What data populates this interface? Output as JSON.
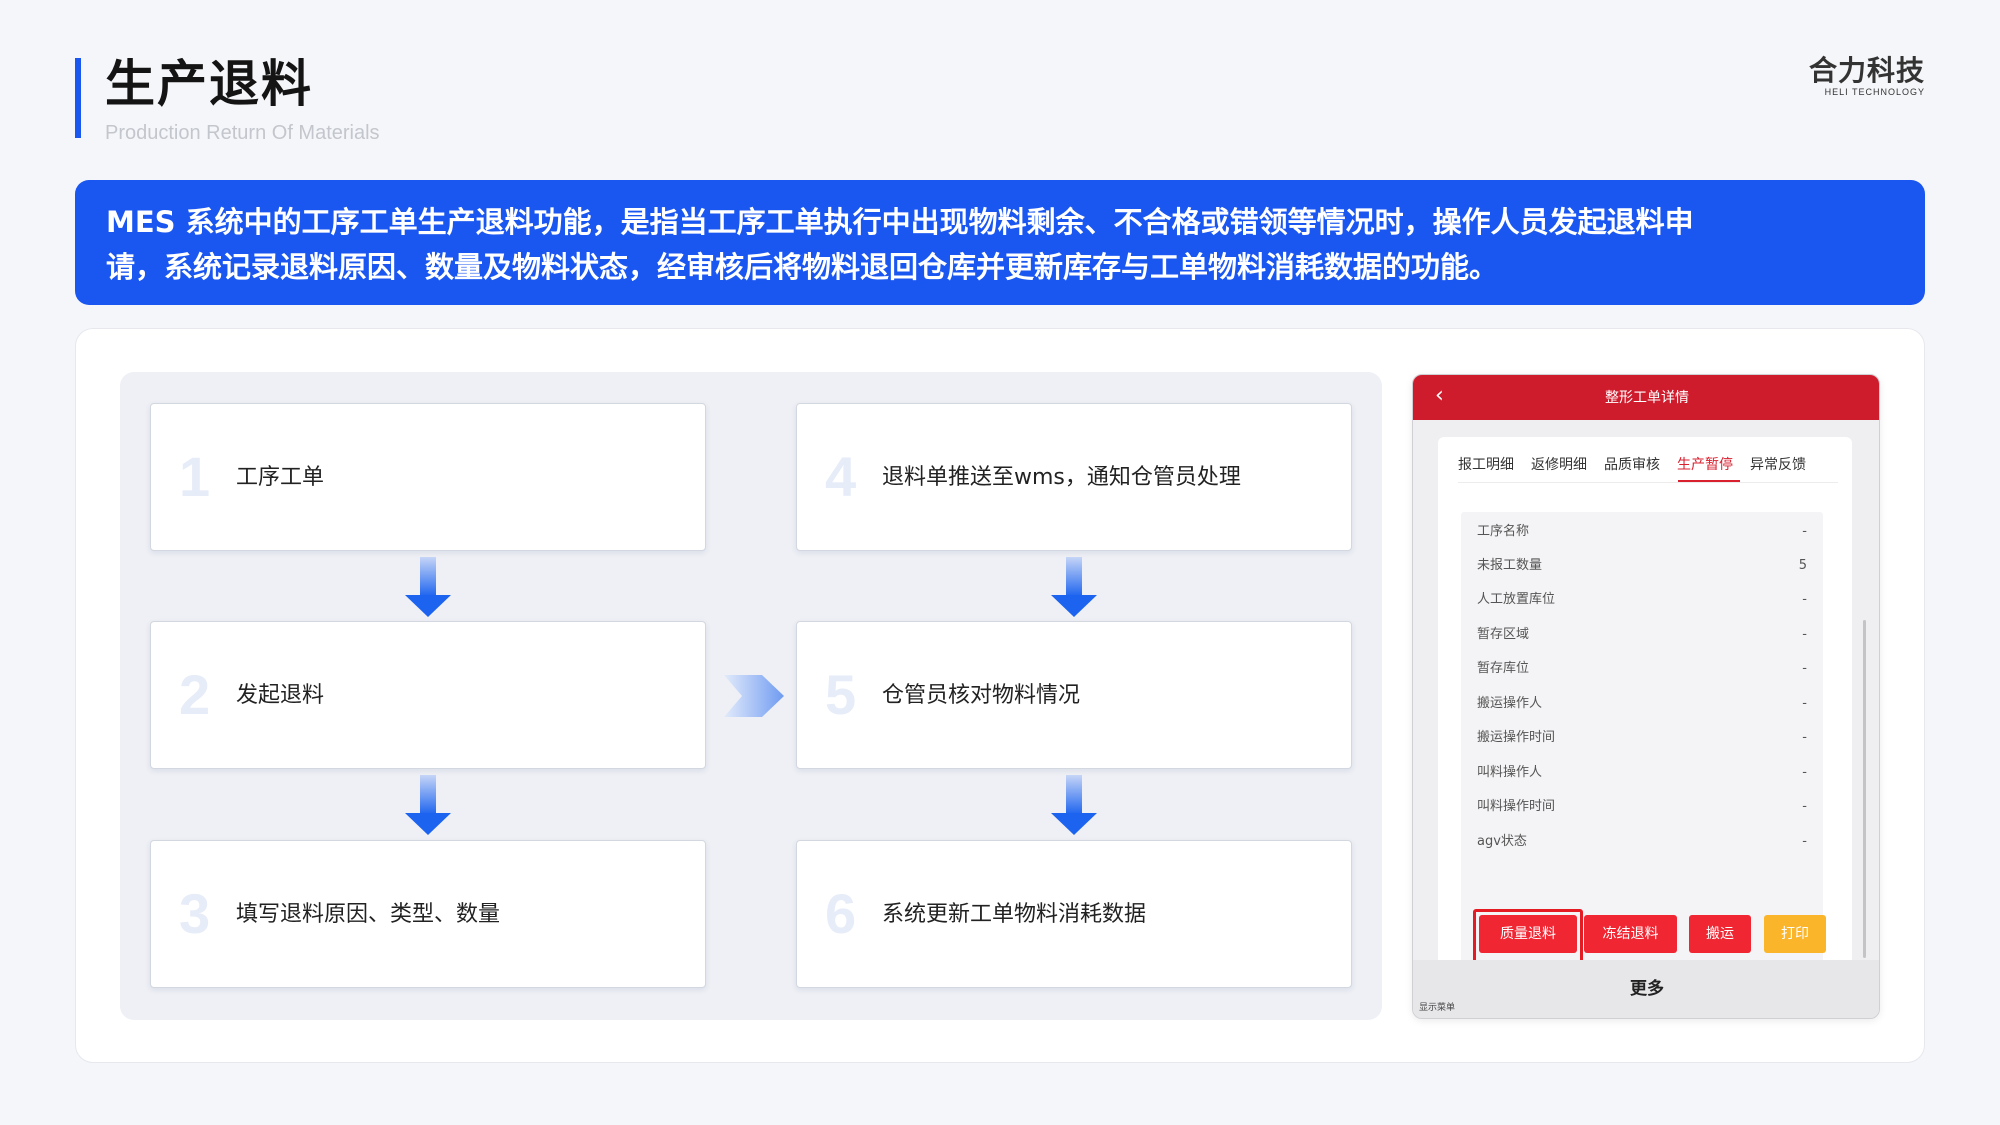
{
  "header": {
    "title": "生产退料",
    "subtitle": "Production Return Of Materials",
    "logo_main": "合力科技",
    "logo_sub": "HELI TECHNOLOGY",
    "accent_color": "#1a56f0"
  },
  "banner": {
    "line1": "MES 系统中的工序工单生产退料功能，是指当工序工单执行中出现物料剩余、不合格或错领等情况时，操作人员发起退料申",
    "line2": "请，系统记录退料原因、数量及物料状态，经审核后将物料退回仓库并更新库存与工单物料消耗数据的功能。"
  },
  "flow": {
    "steps": [
      {
        "num": "1",
        "text": "工序工单"
      },
      {
        "num": "2",
        "text": "发起退料"
      },
      {
        "num": "3",
        "text": "填写退料原因、类型、数量"
      },
      {
        "num": "4",
        "text": "退料单推送至wms，通知仓管员处理"
      },
      {
        "num": "5",
        "text": "仓管员核对物料情况"
      },
      {
        "num": "6",
        "text": "系统更新工单物料消耗数据"
      }
    ],
    "arrow_icon": "arrow-down-icon"
  },
  "phone": {
    "title": "整形工单详情",
    "back_icon": "chevron-left-icon",
    "back_glyph": "‹",
    "header_color": "#cf1c2d",
    "tabs": [
      "报工明细",
      "返修明细",
      "品质审核",
      "生产暂停",
      "异常反馈"
    ],
    "active_tab": "生产暂停",
    "details": [
      {
        "label": "工序名称",
        "value": "-"
      },
      {
        "label": "未报工数量",
        "value": "5"
      },
      {
        "label": "人工放置库位",
        "value": "-"
      },
      {
        "label": "暂存区域",
        "value": "-"
      },
      {
        "label": "暂存库位",
        "value": "-"
      },
      {
        "label": "搬运操作人",
        "value": "-"
      },
      {
        "label": "搬运操作时间",
        "value": "-"
      },
      {
        "label": "叫料操作人",
        "value": "-"
      },
      {
        "label": "叫料操作时间",
        "value": "-"
      },
      {
        "label": "agv状态",
        "value": "-"
      }
    ],
    "buttons": {
      "quality_return": "质量退料",
      "freeze_return": "冻结退料",
      "transport": "搬运",
      "print": "打印"
    },
    "footer_more": "更多",
    "footer_menu": "显示菜单"
  }
}
